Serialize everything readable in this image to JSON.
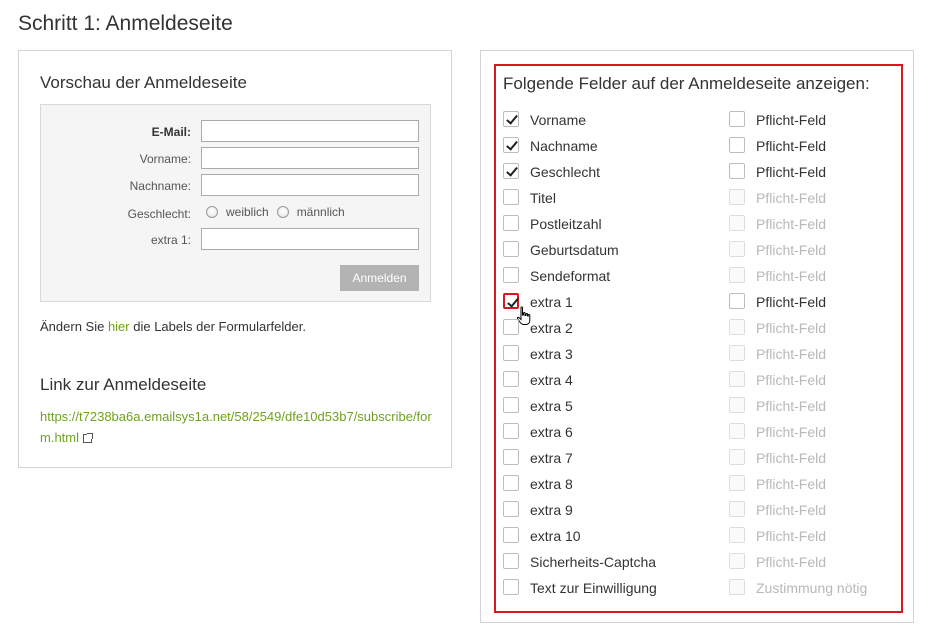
{
  "page_title": "Schritt 1: Anmeldeseite",
  "preview": {
    "heading": "Vorschau der Anmeldeseite",
    "fields": {
      "email_label": "E-Mail:",
      "vorname_label": "Vorname:",
      "nachname_label": "Nachname:",
      "geschlecht_label": "Geschlecht:",
      "weiblich": "weiblich",
      "maennlich": "männlich",
      "extra1_label": "extra 1:"
    },
    "submit_label": "Anmelden"
  },
  "change_hint": {
    "before": "Ändern Sie ",
    "link": "hier",
    "after": " die Labels der Formularfelder."
  },
  "link_section": {
    "heading": "Link zur Anmeldeseite",
    "url": "https://t7238ba6a.emailsys1a.net/58/2549/dfe10d53b7/subscribe/form.html",
    "external_icon": "external-link-icon"
  },
  "fields_panel": {
    "heading": "Folgende Felder auf der Anmeldeseite anzeigen:",
    "rows": [
      {
        "label": "Vorname",
        "checked": true,
        "req_label": "Pflicht-Feld",
        "req_enabled": true
      },
      {
        "label": "Nachname",
        "checked": true,
        "req_label": "Pflicht-Feld",
        "req_enabled": true
      },
      {
        "label": "Geschlecht",
        "checked": true,
        "req_label": "Pflicht-Feld",
        "req_enabled": true
      },
      {
        "label": "Titel",
        "checked": false,
        "req_label": "Pflicht-Feld",
        "req_enabled": false
      },
      {
        "label": "Postleitzahl",
        "checked": false,
        "req_label": "Pflicht-Feld",
        "req_enabled": false
      },
      {
        "label": "Geburtsdatum",
        "checked": false,
        "req_label": "Pflicht-Feld",
        "req_enabled": false
      },
      {
        "label": "Sendeformat",
        "checked": false,
        "req_label": "Pflicht-Feld",
        "req_enabled": false
      },
      {
        "label": "extra 1",
        "checked": true,
        "focused": true,
        "req_label": "Pflicht-Feld",
        "req_enabled": true
      },
      {
        "label": "extra 2",
        "checked": false,
        "req_label": "Pflicht-Feld",
        "req_enabled": false
      },
      {
        "label": "extra 3",
        "checked": false,
        "req_label": "Pflicht-Feld",
        "req_enabled": false
      },
      {
        "label": "extra 4",
        "checked": false,
        "req_label": "Pflicht-Feld",
        "req_enabled": false
      },
      {
        "label": "extra 5",
        "checked": false,
        "req_label": "Pflicht-Feld",
        "req_enabled": false
      },
      {
        "label": "extra 6",
        "checked": false,
        "req_label": "Pflicht-Feld",
        "req_enabled": false
      },
      {
        "label": "extra 7",
        "checked": false,
        "req_label": "Pflicht-Feld",
        "req_enabled": false
      },
      {
        "label": "extra 8",
        "checked": false,
        "req_label": "Pflicht-Feld",
        "req_enabled": false
      },
      {
        "label": "extra 9",
        "checked": false,
        "req_label": "Pflicht-Feld",
        "req_enabled": false
      },
      {
        "label": "extra 10",
        "checked": false,
        "req_label": "Pflicht-Feld",
        "req_enabled": false
      },
      {
        "label": "Sicherheits-Captcha",
        "checked": false,
        "req_label": "Pflicht-Feld",
        "req_enabled": false
      },
      {
        "label": "Text zur Einwilligung",
        "checked": false,
        "req_label": "Zustimmung nötig",
        "req_enabled": false
      }
    ]
  },
  "colors": {
    "link": "#6ea21e",
    "highlight_border": "#d7191f",
    "button_bg": "#b3b3b3"
  }
}
